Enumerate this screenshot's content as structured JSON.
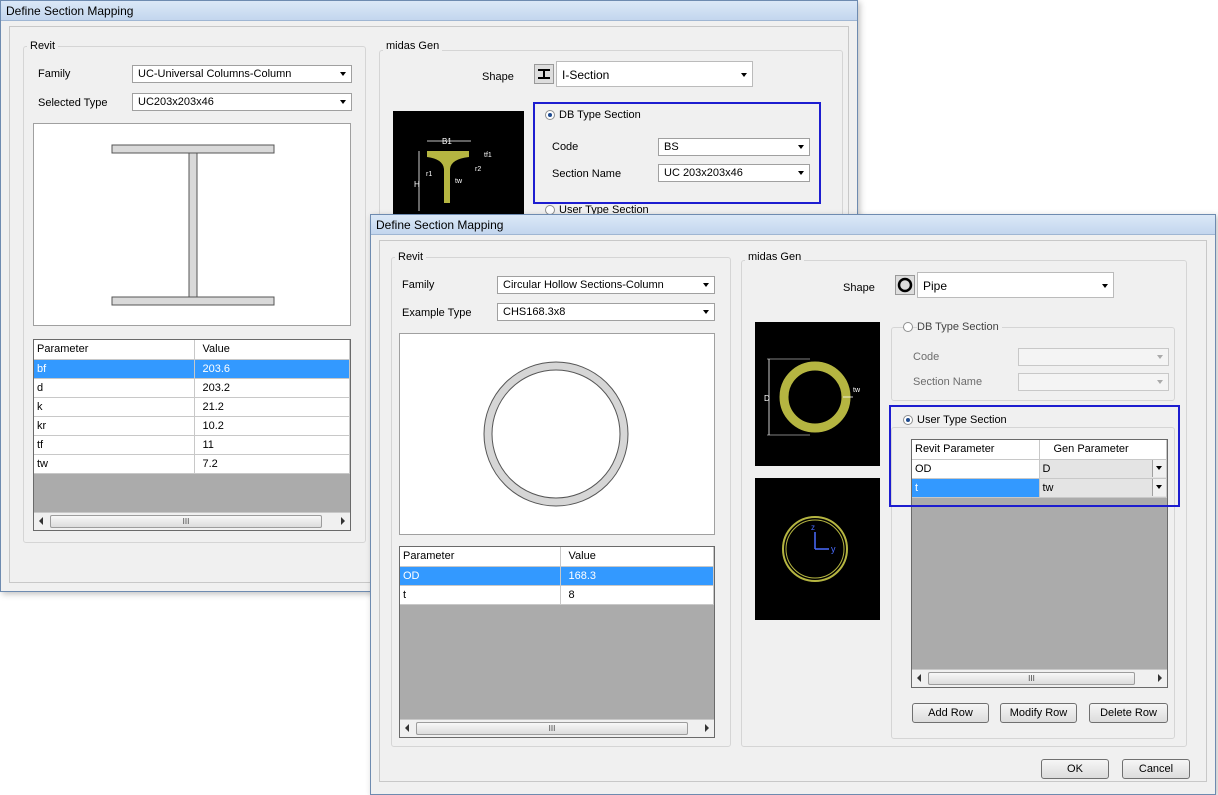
{
  "dialog1": {
    "title": "Define Section Mapping",
    "revit": {
      "group_label": "Revit",
      "family_label": "Family",
      "family_value": "UC-Universal Columns-Column",
      "type_label": "Selected Type",
      "type_value": "UC203x203x46",
      "grid": {
        "headers": [
          "Parameter",
          "Value"
        ],
        "rows": [
          {
            "p": "bf",
            "v": "203.6"
          },
          {
            "p": "d",
            "v": "203.2"
          },
          {
            "p": "k",
            "v": "21.2"
          },
          {
            "p": "kr",
            "v": "10.2"
          },
          {
            "p": "tf",
            "v": "11"
          },
          {
            "p": "tw",
            "v": "7.2"
          }
        ],
        "scroll_glyph": "III"
      }
    },
    "gen": {
      "group_label": "midas Gen",
      "shape_label": "Shape",
      "shape_value": "I-Section",
      "db_label": "DB Type Section",
      "code_label": "Code",
      "code_value": "BS",
      "section_label": "Section Name",
      "section_value": "UC 203x203x46",
      "user_label": "User Type Section",
      "img_labels": {
        "b1": "B1",
        "tf1": "tf1",
        "r1": "r1",
        "r2": "r2",
        "h": "H",
        "tw": "tw"
      }
    }
  },
  "dialog2": {
    "title": "Define Section Mapping",
    "revit": {
      "group_label": "Revit",
      "family_label": "Family",
      "family_value": "Circular Hollow Sections-Column",
      "type_label": "Example Type",
      "type_value": "CHS168.3x8",
      "grid": {
        "headers": [
          "Parameter",
          "Value"
        ],
        "rows": [
          {
            "p": "OD",
            "v": "168.3"
          },
          {
            "p": "t",
            "v": "8"
          }
        ],
        "scroll_glyph": "III"
      }
    },
    "gen": {
      "group_label": "midas Gen",
      "shape_label": "Shape",
      "shape_value": "Pipe",
      "db_label": "DB Type Section",
      "code_label": "Code",
      "section_label": "Section Name",
      "user_label": "User Type Section",
      "img_labels": {
        "d": "D",
        "tw": "tw",
        "z": "z",
        "y": "y"
      },
      "map_grid": {
        "headers": [
          "Revit Parameter",
          "Gen Parameter"
        ],
        "rows": [
          {
            "r": "OD",
            "g": "D"
          },
          {
            "r": "t",
            "g": "tw"
          }
        ],
        "scroll_glyph": "III"
      },
      "add_row": "Add Row",
      "modify_row": "Modify Row",
      "delete_row": "Delete Row"
    },
    "ok": "OK",
    "cancel": "Cancel"
  },
  "colors": {
    "highlight": "#1d1dd0",
    "selection": "#3399ff",
    "section_fill": "#b5b541"
  }
}
